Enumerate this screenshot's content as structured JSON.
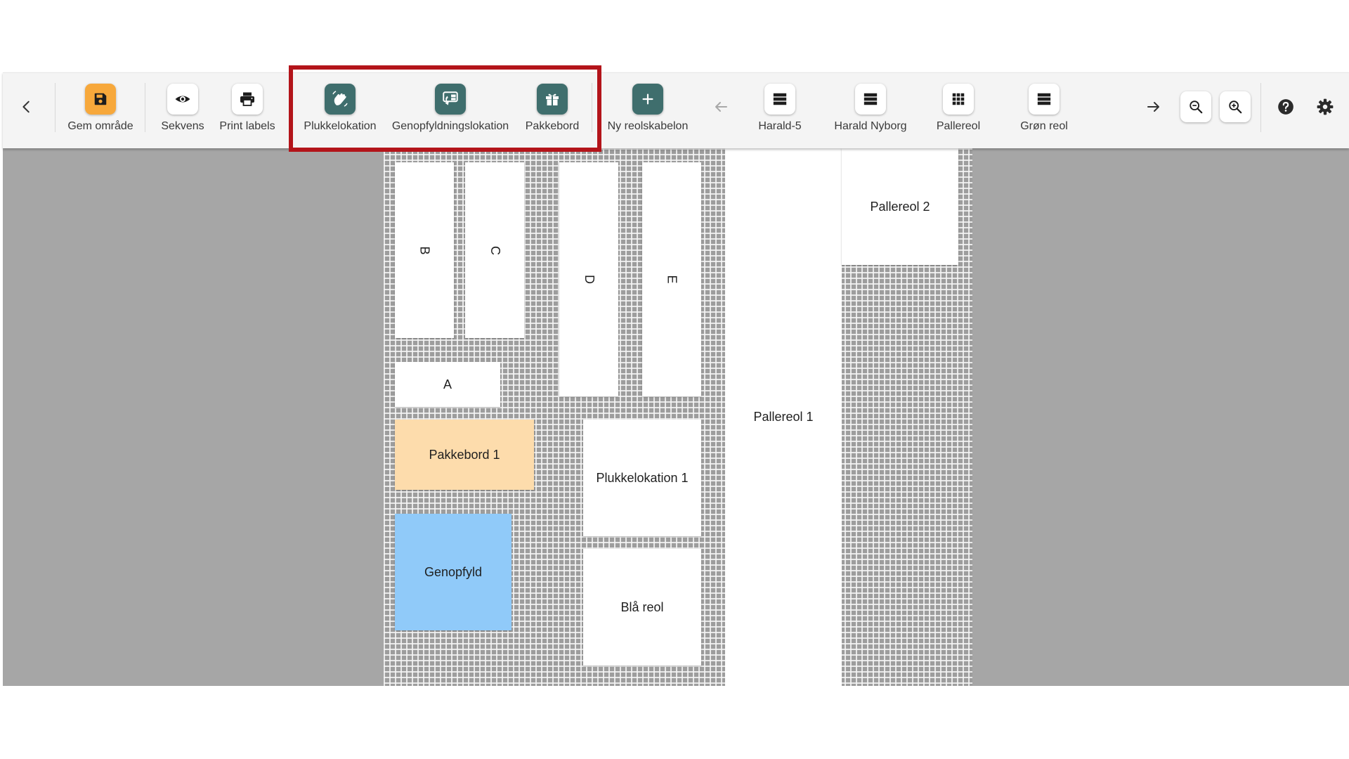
{
  "toolbar": {
    "save_area": "Gem område",
    "sequence": "Sekvens",
    "print_labels": "Print labels",
    "pick_location": "Plukkelokation",
    "replenish_location": "Genopfyldningslokation",
    "packing_table": "Pakkebord",
    "new_shelf_template": "Ny reolskabelon",
    "templates": [
      "Harald-5",
      "Harald Nyborg",
      "Pallereol",
      "Grøn reol"
    ]
  },
  "colors": {
    "accent_orange": "#f7a83b",
    "accent_teal": "#3f6e6d",
    "packing_fill": "#fddcac",
    "replenish_fill": "#90caf9",
    "highlight": "#b3141a"
  },
  "floor": {
    "shelves": {
      "b": "B",
      "c": "C",
      "d": "D",
      "e": "E",
      "a": "A",
      "pakkebord1": "Pakkebord 1",
      "plukkelokation1": "Plukkelokation 1",
      "genopfyld": "Genopfyld",
      "blaa_reol": "Blå reol",
      "pallereol1": "Pallereol 1",
      "pallereol2": "Pallereol 2"
    }
  }
}
